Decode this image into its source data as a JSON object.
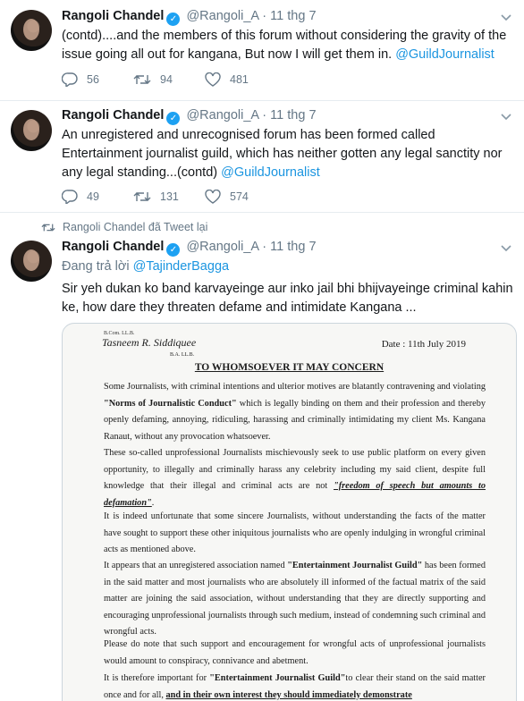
{
  "tweets": [
    {
      "name": "Rangoli Chandel",
      "handle": "@Rangoli_A",
      "dot": "·",
      "time": "11 thg 7",
      "text": "(contd)....and the members of this forum without considering the gravity of the issue going all out for kangana, But now I will get them in.",
      "mention": "@GuildJournalist",
      "replies": "56",
      "retweets": "94",
      "likes": "481"
    },
    {
      "name": "Rangoli Chandel",
      "handle": "@Rangoli_A",
      "dot": "·",
      "time": "11 thg 7",
      "text": "An unregistered and unrecognised forum has been formed called Entertainment journalist guild, which has neither gotten any legal sanctity nor any legal standing...(contd)",
      "mention": "@GuildJournalist",
      "replies": "49",
      "retweets": "131",
      "likes": "574"
    },
    {
      "retweet_label": "Rangoli Chandel đã Tweet lại",
      "name": "Rangoli Chandel",
      "handle": "@Rangoli_A",
      "dot": "·",
      "time": "11 thg 7",
      "reply_prefix": "Đang trả lời",
      "reply_to": "@TajinderBagga",
      "text": "Sir yeh dukan ko band karvayeinge aur inko jail bhi bhijvayeinge criminal kahin ke, how dare they threaten defame and intimidate Kangana ..."
    }
  ],
  "document": {
    "lh_top": "B.Com. LL.B.",
    "lh_name": "Tasneem R. Siddiquee",
    "lh_deg": "B.A. LL.B.",
    "date": "Date : 11th July 2019",
    "title": "TO WHOMSOEVER IT MAY CONCERN",
    "p1a": "Some Journalists, with criminal intentions and ulterior motives are blatantly contravening and violating ",
    "p1b": "\"Norms of Journalistic Conduct\"",
    "p1c": " which is legally binding on them and their profession and thereby openly defaming, annoying, ridiculing, harassing and criminally intimidating my client Ms. Kangana Ranaut, without any provocation whatsoever.",
    "p2a": "These so-called unprofessional Journalists mischievously seek to use public platform on every given opportunity, to illegally and criminally harass any celebrity including my said client, despite full knowledge that their illegal and criminal acts are not ",
    "p2b": "\"freedom of speech but amounts to defamation\"",
    "p2c": ".",
    "p3": "It is indeed unfortunate that some sincere Journalists, without understanding the facts of the matter have sought to support these other iniquitous journalists who are openly indulging in wrongful criminal acts as mentioned above.",
    "p4a": "It appears that an unregistered association named ",
    "p4b": "\"Entertainment Journalist Guild\"",
    "p4c": " has been formed in the said matter and most journalists who are absolutely ill informed of the factual matrix of the said matter are joining the said association, without understanding that they are directly supporting and encouraging unprofessional journalists through such medium, instead of condemning such criminal and wrongful acts.",
    "p5": "Please do note that such support and encouragement for wrongful acts of unprofessional journalists would amount to conspiracy, connivance and abetment.",
    "p6a": "It is therefore important for ",
    "p6b": "\"Entertainment Journalist Guild\"",
    "p6c": "to clear their stand on the said matter once and for all, ",
    "p6d": "and in their own interest they should immediately demonstrate"
  },
  "colors": {
    "link": "#1b95e0",
    "verified": "#1da1f2",
    "muted": "#657786"
  }
}
